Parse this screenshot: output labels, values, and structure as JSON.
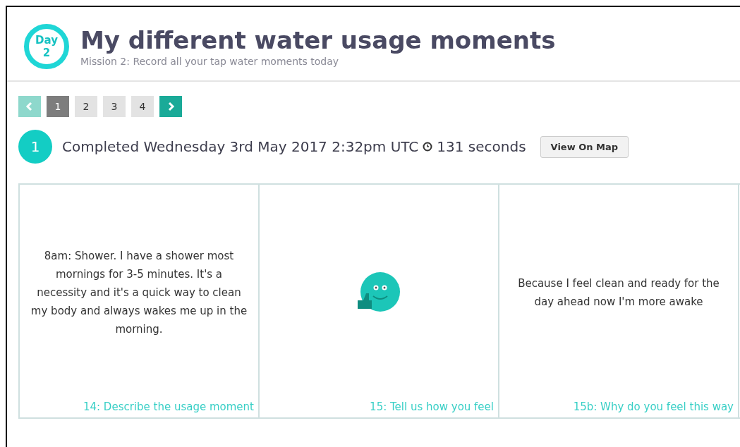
{
  "header": {
    "badge_label": "Day",
    "badge_number": "2",
    "title": "My different water usage moments",
    "subtitle": "Mission 2: Record all your tap water moments today"
  },
  "pagination": {
    "prev_disabled": true,
    "pages": [
      {
        "label": "1",
        "selected": true
      },
      {
        "label": "2",
        "selected": false
      },
      {
        "label": "3",
        "selected": false
      },
      {
        "label": "4",
        "selected": false
      }
    ],
    "next_disabled": false
  },
  "entry": {
    "number": "1",
    "completed": "Completed Wednesday 3rd May 2017 2:32pm UTC",
    "duration": "131 seconds",
    "map_button": "View On Map"
  },
  "cards": [
    {
      "kind": "text",
      "text": "8am: Shower. I have a shower most mornings for 3-5 minutes. It's a necessity and it's a quick way to clean my body and always wakes me up in the morning.",
      "caption": "14: Describe the usage moment"
    },
    {
      "kind": "emoji",
      "caption": "15: Tell us how you feel"
    },
    {
      "kind": "text",
      "text": "Because I feel clean and ready for the day ahead now I'm more awake",
      "caption": "15b: Why do you feel this way"
    }
  ]
}
